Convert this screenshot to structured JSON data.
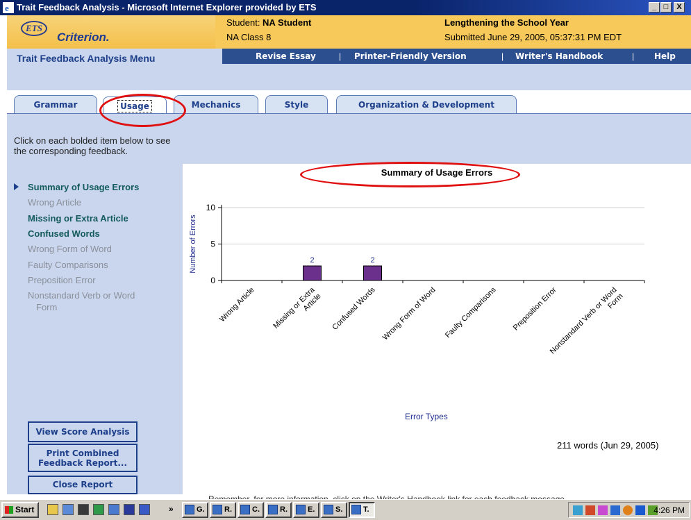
{
  "window": {
    "title": "Trait Feedback Analysis - Microsoft Internet Explorer provided by ETS",
    "controls": [
      "_",
      "□",
      "X"
    ]
  },
  "header": {
    "logo_small": "ETS",
    "logo_main": "Criterion.",
    "student_label": "Student: ",
    "student_name": "NA Student",
    "class_name": "NA Class 8",
    "essay_title": "Lengthening the School Year",
    "submitted": "Submitted June 29, 2005, 05:37:31 PM EDT"
  },
  "menu": {
    "title": "Trait Feedback Analysis Menu",
    "links": [
      "Revise Essay",
      "Printer-Friendly Version",
      "Writer's Handbook",
      "Help"
    ],
    "separator": "|"
  },
  "tabs": [
    {
      "label": "Grammar",
      "active": false
    },
    {
      "label": "Usage",
      "active": true
    },
    {
      "label": "Mechanics",
      "active": false
    },
    {
      "label": "Style",
      "active": false
    },
    {
      "label": "Organization & Development",
      "active": false
    }
  ],
  "sidebar": {
    "instructions": "Click on each bolded item below to see the corresponding feedback.",
    "items": [
      {
        "label": "Summary of Usage Errors",
        "style": "current"
      },
      {
        "label": "Wrong Article",
        "style": "disabled"
      },
      {
        "label": "Missing or Extra Article",
        "style": "bold"
      },
      {
        "label": "Confused Words",
        "style": "bold"
      },
      {
        "label": "Wrong Form of Word",
        "style": "disabled"
      },
      {
        "label": "Faulty Comparisons",
        "style": "disabled"
      },
      {
        "label": "Preposition Error",
        "style": "disabled"
      },
      {
        "label": "Nonstandard Verb or Word",
        "style": "disabled"
      },
      {
        "label": "Form",
        "style": "disabled"
      }
    ],
    "buttons": {
      "score_analysis": "View Score Analysis",
      "print_line1": "Print Combined",
      "print_line2": "Feedback Report...",
      "close": "Close Report"
    }
  },
  "chart_data": {
    "type": "bar",
    "title": "Summary of Usage Errors",
    "xlabel": "Error Types",
    "ylabel": "Number of Errors",
    "ylim": [
      0,
      10
    ],
    "yticks": [
      0,
      5,
      10
    ],
    "categories": [
      "Wrong Article",
      "Missing or Extra Article",
      "Confused Words",
      "Wrong Form of Word",
      "Faulty Comparisons",
      "Preposition Error",
      "Nonstandard Verb or Word Form"
    ],
    "values": [
      0,
      2,
      2,
      0,
      0,
      0,
      0
    ],
    "data_labels": [
      "",
      "2",
      "2",
      "",
      "",
      "",
      ""
    ],
    "bar_color": "#6b2f8c",
    "grid": true
  },
  "word_count": "211 words (Jun 29, 2005)",
  "reminder": "Remember, for more information, click on the Writer's Handbook link for each feedback message.",
  "taskbar": {
    "start": "Start",
    "chevron": "»",
    "tasks": [
      "G.",
      "R.",
      "C.",
      "R.",
      "E.",
      "S.",
      "T."
    ],
    "clock": "4:26 PM"
  },
  "colors": {
    "annotation": "#e01010",
    "menu_bar": "#2c4f8f",
    "panel_bg": "#c9d6ee",
    "header_gold": "#f7c85a"
  }
}
